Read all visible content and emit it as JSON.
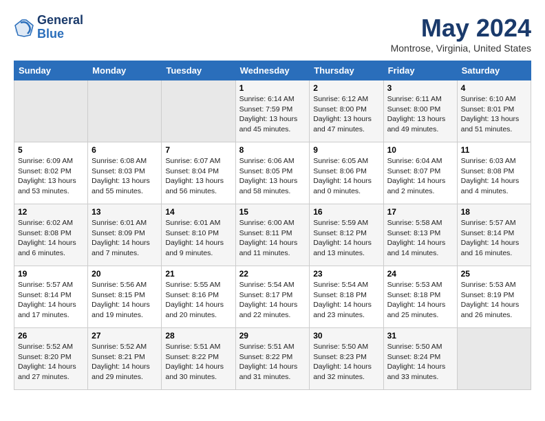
{
  "header": {
    "logo_line1": "General",
    "logo_line2": "Blue",
    "month_title": "May 2024",
    "location": "Montrose, Virginia, United States"
  },
  "days_of_week": [
    "Sunday",
    "Monday",
    "Tuesday",
    "Wednesday",
    "Thursday",
    "Friday",
    "Saturday"
  ],
  "weeks": [
    [
      {
        "day": "",
        "info": ""
      },
      {
        "day": "",
        "info": ""
      },
      {
        "day": "",
        "info": ""
      },
      {
        "day": "1",
        "info": "Sunrise: 6:14 AM\nSunset: 7:59 PM\nDaylight: 13 hours\nand 45 minutes."
      },
      {
        "day": "2",
        "info": "Sunrise: 6:12 AM\nSunset: 8:00 PM\nDaylight: 13 hours\nand 47 minutes."
      },
      {
        "day": "3",
        "info": "Sunrise: 6:11 AM\nSunset: 8:00 PM\nDaylight: 13 hours\nand 49 minutes."
      },
      {
        "day": "4",
        "info": "Sunrise: 6:10 AM\nSunset: 8:01 PM\nDaylight: 13 hours\nand 51 minutes."
      }
    ],
    [
      {
        "day": "5",
        "info": "Sunrise: 6:09 AM\nSunset: 8:02 PM\nDaylight: 13 hours\nand 53 minutes."
      },
      {
        "day": "6",
        "info": "Sunrise: 6:08 AM\nSunset: 8:03 PM\nDaylight: 13 hours\nand 55 minutes."
      },
      {
        "day": "7",
        "info": "Sunrise: 6:07 AM\nSunset: 8:04 PM\nDaylight: 13 hours\nand 56 minutes."
      },
      {
        "day": "8",
        "info": "Sunrise: 6:06 AM\nSunset: 8:05 PM\nDaylight: 13 hours\nand 58 minutes."
      },
      {
        "day": "9",
        "info": "Sunrise: 6:05 AM\nSunset: 8:06 PM\nDaylight: 14 hours\nand 0 minutes."
      },
      {
        "day": "10",
        "info": "Sunrise: 6:04 AM\nSunset: 8:07 PM\nDaylight: 14 hours\nand 2 minutes."
      },
      {
        "day": "11",
        "info": "Sunrise: 6:03 AM\nSunset: 8:08 PM\nDaylight: 14 hours\nand 4 minutes."
      }
    ],
    [
      {
        "day": "12",
        "info": "Sunrise: 6:02 AM\nSunset: 8:08 PM\nDaylight: 14 hours\nand 6 minutes."
      },
      {
        "day": "13",
        "info": "Sunrise: 6:01 AM\nSunset: 8:09 PM\nDaylight: 14 hours\nand 7 minutes."
      },
      {
        "day": "14",
        "info": "Sunrise: 6:01 AM\nSunset: 8:10 PM\nDaylight: 14 hours\nand 9 minutes."
      },
      {
        "day": "15",
        "info": "Sunrise: 6:00 AM\nSunset: 8:11 PM\nDaylight: 14 hours\nand 11 minutes."
      },
      {
        "day": "16",
        "info": "Sunrise: 5:59 AM\nSunset: 8:12 PM\nDaylight: 14 hours\nand 13 minutes."
      },
      {
        "day": "17",
        "info": "Sunrise: 5:58 AM\nSunset: 8:13 PM\nDaylight: 14 hours\nand 14 minutes."
      },
      {
        "day": "18",
        "info": "Sunrise: 5:57 AM\nSunset: 8:14 PM\nDaylight: 14 hours\nand 16 minutes."
      }
    ],
    [
      {
        "day": "19",
        "info": "Sunrise: 5:57 AM\nSunset: 8:14 PM\nDaylight: 14 hours\nand 17 minutes."
      },
      {
        "day": "20",
        "info": "Sunrise: 5:56 AM\nSunset: 8:15 PM\nDaylight: 14 hours\nand 19 minutes."
      },
      {
        "day": "21",
        "info": "Sunrise: 5:55 AM\nSunset: 8:16 PM\nDaylight: 14 hours\nand 20 minutes."
      },
      {
        "day": "22",
        "info": "Sunrise: 5:54 AM\nSunset: 8:17 PM\nDaylight: 14 hours\nand 22 minutes."
      },
      {
        "day": "23",
        "info": "Sunrise: 5:54 AM\nSunset: 8:18 PM\nDaylight: 14 hours\nand 23 minutes."
      },
      {
        "day": "24",
        "info": "Sunrise: 5:53 AM\nSunset: 8:18 PM\nDaylight: 14 hours\nand 25 minutes."
      },
      {
        "day": "25",
        "info": "Sunrise: 5:53 AM\nSunset: 8:19 PM\nDaylight: 14 hours\nand 26 minutes."
      }
    ],
    [
      {
        "day": "26",
        "info": "Sunrise: 5:52 AM\nSunset: 8:20 PM\nDaylight: 14 hours\nand 27 minutes."
      },
      {
        "day": "27",
        "info": "Sunrise: 5:52 AM\nSunset: 8:21 PM\nDaylight: 14 hours\nand 29 minutes."
      },
      {
        "day": "28",
        "info": "Sunrise: 5:51 AM\nSunset: 8:22 PM\nDaylight: 14 hours\nand 30 minutes."
      },
      {
        "day": "29",
        "info": "Sunrise: 5:51 AM\nSunset: 8:22 PM\nDaylight: 14 hours\nand 31 minutes."
      },
      {
        "day": "30",
        "info": "Sunrise: 5:50 AM\nSunset: 8:23 PM\nDaylight: 14 hours\nand 32 minutes."
      },
      {
        "day": "31",
        "info": "Sunrise: 5:50 AM\nSunset: 8:24 PM\nDaylight: 14 hours\nand 33 minutes."
      },
      {
        "day": "",
        "info": ""
      }
    ]
  ]
}
